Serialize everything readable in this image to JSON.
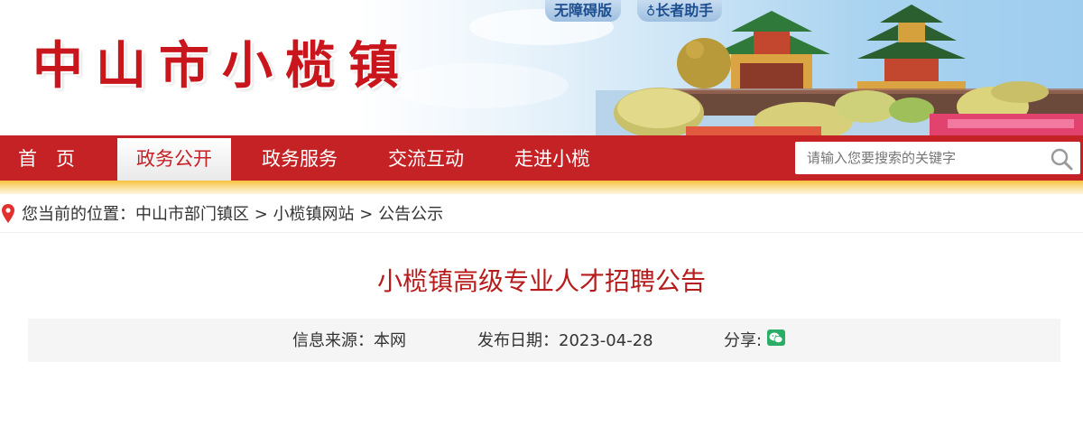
{
  "header": {
    "site_title": "中山市小榄镇",
    "accessibility_label": "无障碍版",
    "elder_label": "长者助手"
  },
  "nav": {
    "items": [
      {
        "label": "首　页"
      },
      {
        "label": "政务公开",
        "active": true
      },
      {
        "label": "政务服务"
      },
      {
        "label": "交流互动"
      },
      {
        "label": "走进小榄"
      }
    ]
  },
  "search": {
    "placeholder": "请输入您要搜索的关键字",
    "icon": "search-icon"
  },
  "breadcrumb": {
    "prefix": "您当前的位置：",
    "items": [
      "中山市部门镇区",
      "小榄镇网站",
      "公告公示"
    ],
    "separator": ">"
  },
  "article": {
    "title": "小榄镇高级专业人才招聘公告",
    "source_label": "信息来源：",
    "source_value": "本网",
    "date_label": "发布日期：",
    "date_value": "2023-04-28",
    "share_label": "分享:",
    "share_icon": "wechat-icon"
  },
  "colors": {
    "nav_red": "#c52226",
    "title_red": "#b71c1c",
    "gold": "#f6c142"
  }
}
